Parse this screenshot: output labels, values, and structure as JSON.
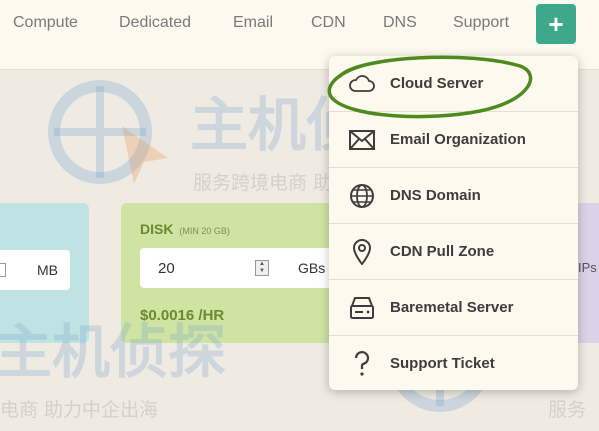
{
  "nav": {
    "items": [
      "Compute",
      "Dedicated",
      "Email",
      "CDN",
      "DNS",
      "Support"
    ],
    "plus_label": "+"
  },
  "watermark": {
    "main": "主机侦探",
    "sub": "服务跨境电商 助力中企出海",
    "sub2": "电商 助力中企出海",
    "sub3": "服务"
  },
  "memory_card": {
    "unit": "MB"
  },
  "disk_card": {
    "title": "DISK",
    "subtitle": "(MIN 20 GB)",
    "value": "20",
    "unit": "GBs",
    "price": "$0.0016",
    "price_unit": "/HR"
  },
  "ips_card": {
    "text": "IPs"
  },
  "dropdown": {
    "items": [
      {
        "label": "Cloud Server",
        "icon": "cloud-icon"
      },
      {
        "label": "Email Organization",
        "icon": "envelope-icon"
      },
      {
        "label": "DNS Domain",
        "icon": "globe-icon"
      },
      {
        "label": "CDN Pull Zone",
        "icon": "map-pin-icon"
      },
      {
        "label": "Baremetal Server",
        "icon": "server-icon"
      },
      {
        "label": "Support Ticket",
        "icon": "question-icon"
      }
    ]
  },
  "colors": {
    "accent": "#3ea98a",
    "annotation": "#4f8a1f",
    "disk_card": "#cfe3a3",
    "memory_card": "#bfe3e3"
  }
}
